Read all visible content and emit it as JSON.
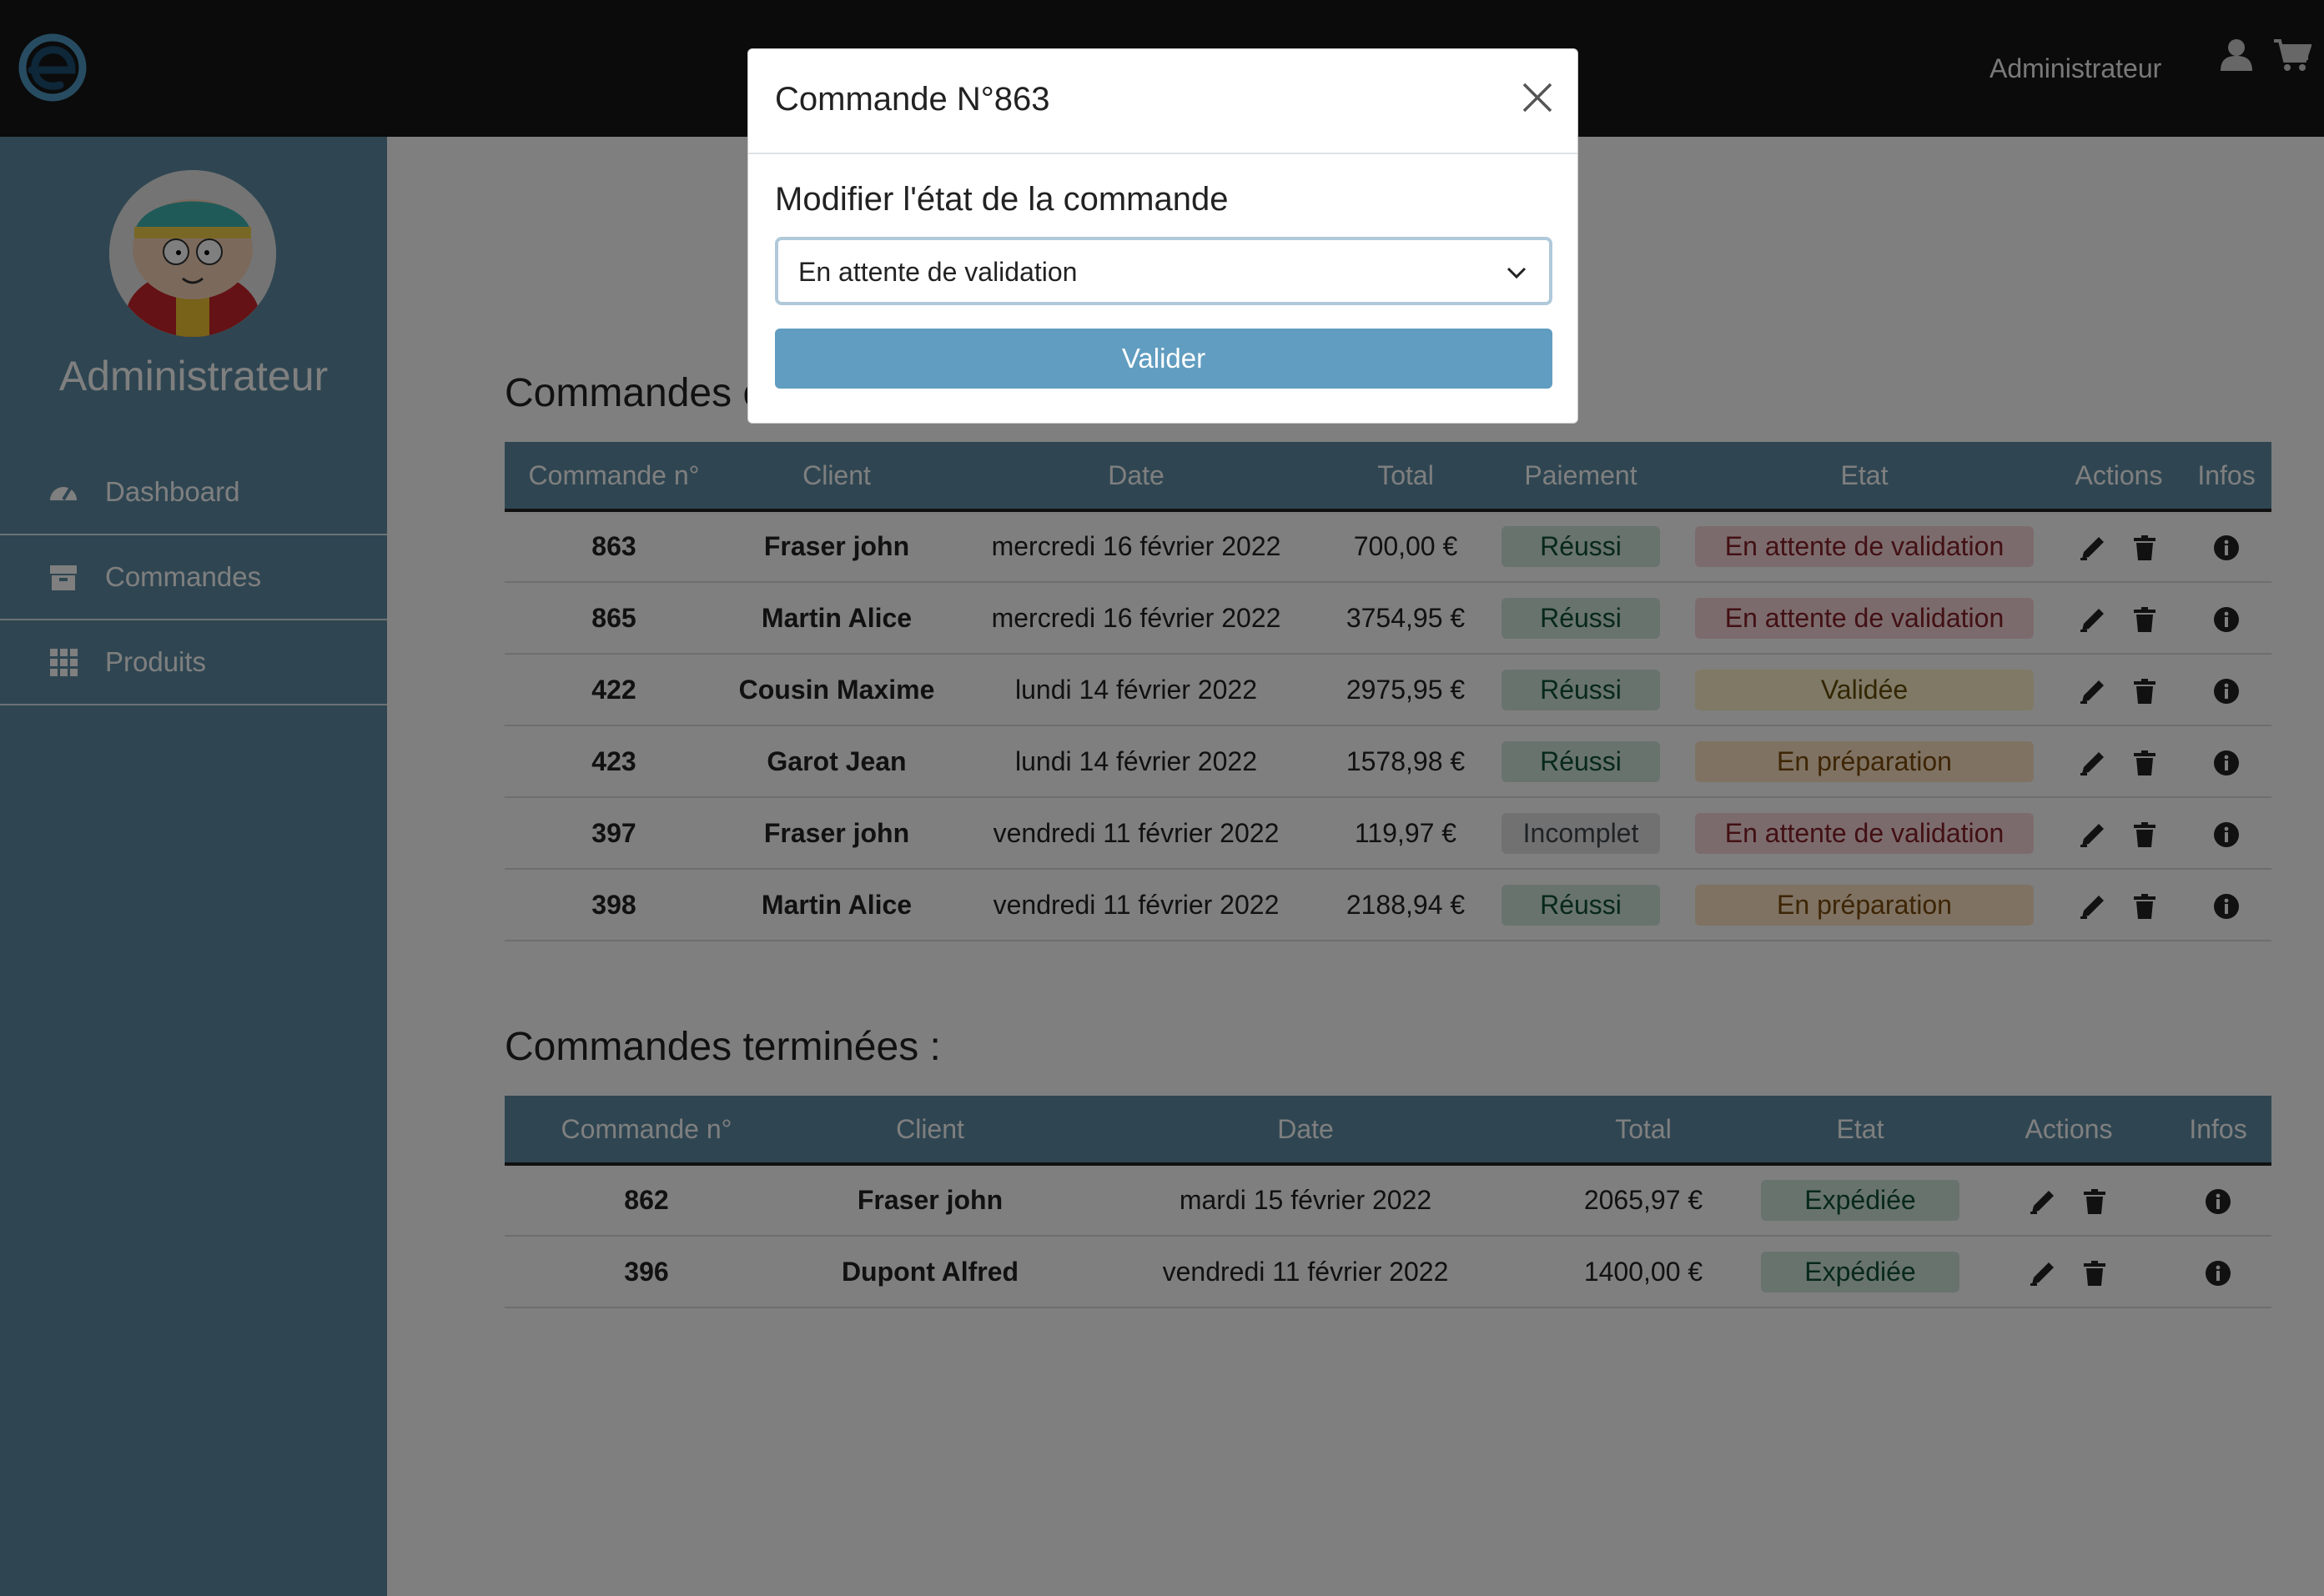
{
  "navbar": {
    "user_label": "Administrateur"
  },
  "sidebar": {
    "title": "Administrateur",
    "items": [
      {
        "label": "Dashboard",
        "icon": "dashboard-icon"
      },
      {
        "label": "Commandes",
        "icon": "box-icon"
      },
      {
        "label": "Produits",
        "icon": "grid-icon"
      }
    ]
  },
  "current": {
    "title": "Commandes e",
    "headers": [
      "Commande n°",
      "Client",
      "Date",
      "Total",
      "Paiement",
      "Etat",
      "Actions",
      "Infos"
    ],
    "rows": [
      {
        "num": "863",
        "client": "Fraser john",
        "date": "mercredi 16 février 2022",
        "total": "700,00 €",
        "paiement": "Réussi",
        "etat": "En attente de validation"
      },
      {
        "num": "865",
        "client": "Martin Alice",
        "date": "mercredi 16 février 2022",
        "total": "3754,95 €",
        "paiement": "Réussi",
        "etat": "En attente de validation"
      },
      {
        "num": "422",
        "client": "Cousin Maxime",
        "date": "lundi 14 février 2022",
        "total": "2975,95 €",
        "paiement": "Réussi",
        "etat": "Validée"
      },
      {
        "num": "423",
        "client": "Garot Jean",
        "date": "lundi 14 février 2022",
        "total": "1578,98 €",
        "paiement": "Réussi",
        "etat": "En préparation"
      },
      {
        "num": "397",
        "client": "Fraser john",
        "date": "vendredi 11 février 2022",
        "total": "119,97 €",
        "paiement": "Incomplet",
        "etat": "En attente de validation"
      },
      {
        "num": "398",
        "client": "Martin Alice",
        "date": "vendredi 11 février 2022",
        "total": "2188,94 €",
        "paiement": "Réussi",
        "etat": "En préparation"
      }
    ]
  },
  "finished": {
    "title": "Commandes terminées :",
    "headers": [
      "Commande n°",
      "Client",
      "Date",
      "Total",
      "Etat",
      "Actions",
      "Infos"
    ],
    "rows": [
      {
        "num": "862",
        "client": "Fraser john",
        "date": "mardi 15 février 2022",
        "total": "2065,97 €",
        "etat": "Expédiée"
      },
      {
        "num": "396",
        "client": "Dupont Alfred",
        "date": "vendredi 11 février 2022",
        "total": "1400,00 €",
        "etat": "Expédiée"
      }
    ]
  },
  "modal": {
    "title": "Commande N°863",
    "label": "Modifier l'état de la commande",
    "selected": "En attente de validation",
    "button": "Valider"
  },
  "colors": {
    "navbar": "#171717",
    "sidebar": "#5f8ca5",
    "table_header": "#5f8ca5",
    "primary_button": "#619dc0"
  }
}
